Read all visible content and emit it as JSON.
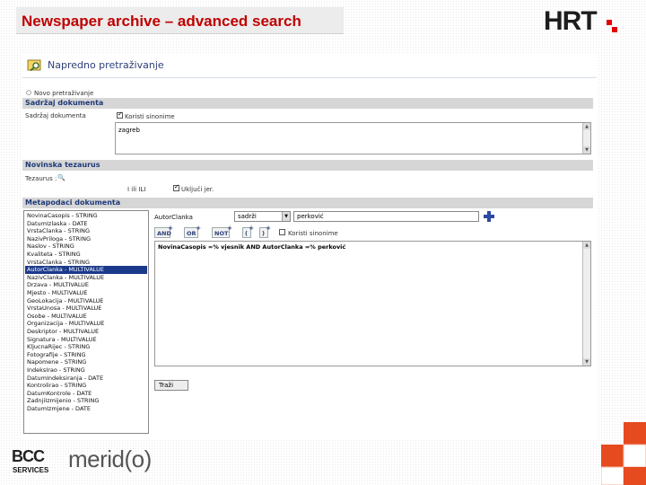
{
  "slide": {
    "title": "Newspaper archive – advanced search",
    "hrt_logo_text": "HRT",
    "accent_red": "#c00000"
  },
  "app": {
    "header_title": "Napredno pretraživanje",
    "new_search_label": "Novo pretraživanje",
    "sections": {
      "content": "Sadržaj dokumenta",
      "thesaurus": "Novinska tezaurus",
      "metadata": "Metapodaci dokumenta"
    },
    "content": {
      "field_label": "Sadržaj dokumenta",
      "synonyms_label": "Koristi sinonime",
      "query_text": "zagreb"
    },
    "thesaurus": {
      "field_label": "Tezaurus :",
      "mode_label": "I  ili  ILI",
      "hierarchy_label": "Uključi jer."
    },
    "metadata": {
      "list_items": [
        "NovinaCasopis - STRING",
        "DatumIzlaska - DATE",
        "VrstaClanka - STRING",
        "NazivPriloga - STRING",
        "Naslov - STRING",
        "Kvaliteta - STRING",
        "VrstaClanka - STRING",
        "AutorClanka - MULTIVALUE",
        "NazivClanka - MULTIVALUE",
        "Drzava - MULTIVALUE",
        "Mjesto - MULTIVALUE",
        "GeoLokacija - MULTIVALUE",
        "VrstaUnosa - MULTIVALUE",
        "Osobe - MULTIVALUE",
        "Organizacija - MULTIVALUE",
        "Deskriptor - MULTIVALUE",
        "Signatura - MULTIVALUE",
        "KljucnaRijec - STRING",
        "Fotografije - STRING",
        "Napomene - STRING",
        "IndeksIrao - STRING",
        "DatumIndeksiranja - DATE",
        "Kontrolirao - STRING",
        "DatumKontrole - DATE",
        "ZadnjiIzmijenio - STRING",
        "DatumIzmjene - DATE"
      ],
      "selected_index": 7,
      "field_label": "AutorClanka",
      "operator_value": "sadrži",
      "value_text": "perković",
      "synonyms_label": "Koristi sinonime",
      "ops": [
        "AND",
        "OR",
        "NOT",
        "(",
        ")"
      ],
      "query_text": "NovinaCasopis =% vjesnik  AND AutorClanka =% perković",
      "search_label": "Traži"
    }
  },
  "footer": {
    "bcc_text": "BCC",
    "services_text": "SERVICES",
    "meridio_text": "merid(o)"
  }
}
